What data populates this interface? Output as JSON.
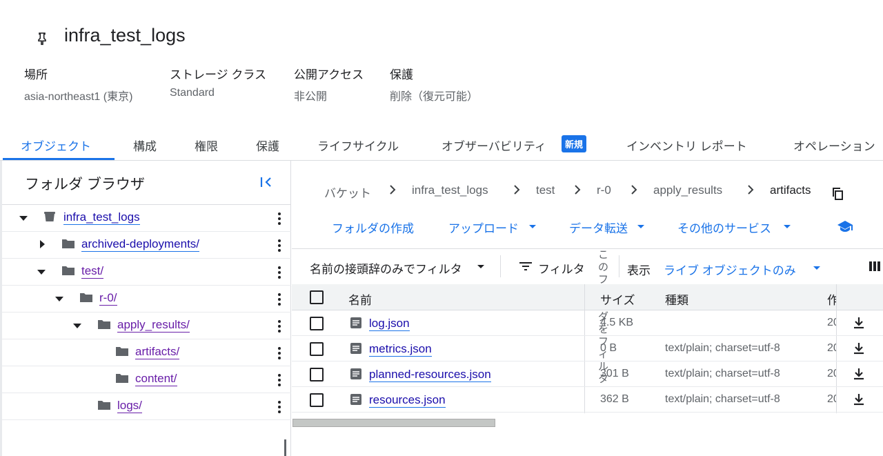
{
  "bucket": {
    "title": "infra_test_logs",
    "pin_icon": "pin-icon"
  },
  "meta": {
    "location_label": "場所",
    "location_value": "asia-northeast1 (東京)",
    "storage_class_label": "ストレージ クラス",
    "storage_class_value": "Standard",
    "public_access_label": "公開アクセス",
    "public_access_value": "非公開",
    "protection_label": "保護",
    "protection_value": "削除（復元可能）"
  },
  "tabs": [
    {
      "label": "オブジェクト",
      "active": true
    },
    {
      "label": "構成"
    },
    {
      "label": "権限"
    },
    {
      "label": "保護"
    },
    {
      "label": "ライフサイクル"
    },
    {
      "label": "オブザーバビリティ"
    },
    {
      "label": "インベントリ レポート"
    },
    {
      "label": "オペレーション"
    }
  ],
  "new_badge": "新規",
  "folder_browser": {
    "title": "フォルダ ブラウザ",
    "tree": [
      {
        "label": "infra_test_logs"
      },
      {
        "label": "archived-deployments/"
      },
      {
        "label": "test/"
      },
      {
        "label": "r-0/"
      },
      {
        "label": "apply_results/"
      },
      {
        "label": "artifacts/"
      },
      {
        "label": "content/"
      },
      {
        "label": "logs/"
      }
    ]
  },
  "breadcrumb": [
    "バケット",
    "infra_test_logs",
    "test",
    "r-0",
    "apply_results",
    "artifacts"
  ],
  "actions": {
    "create_folder": "フォルダの作成",
    "upload": "アップロード",
    "data_transfer": "データ転送",
    "other_services": "その他のサービス"
  },
  "filter": {
    "prefix_filter": "名前の接頭辞のみでフィルタ",
    "filter": "フィルタ",
    "overlay_text": "このフォルダをフィルタ",
    "display_label": "表示",
    "display_value": "ライブ オブジェクトのみ"
  },
  "table": {
    "headers": {
      "name": "名前",
      "size": "サイズ",
      "type": "種類",
      "created": "作"
    },
    "rows": [
      {
        "name": "log.json",
        "size": "4.5 KB",
        "type": "",
        "created": "20"
      },
      {
        "name": "metrics.json",
        "size": "0 B",
        "type": "text/plain; charset=utf-8",
        "created": "20"
      },
      {
        "name": "planned-resources.json",
        "size": "301 B",
        "type": "text/plain; charset=utf-8",
        "created": "20"
      },
      {
        "name": "resources.json",
        "size": "362 B",
        "type": "text/plain; charset=utf-8",
        "created": "20"
      }
    ]
  },
  "colors": {
    "accent": "#1a73e8",
    "link": "#1a0dab",
    "visited": "#681da8"
  }
}
